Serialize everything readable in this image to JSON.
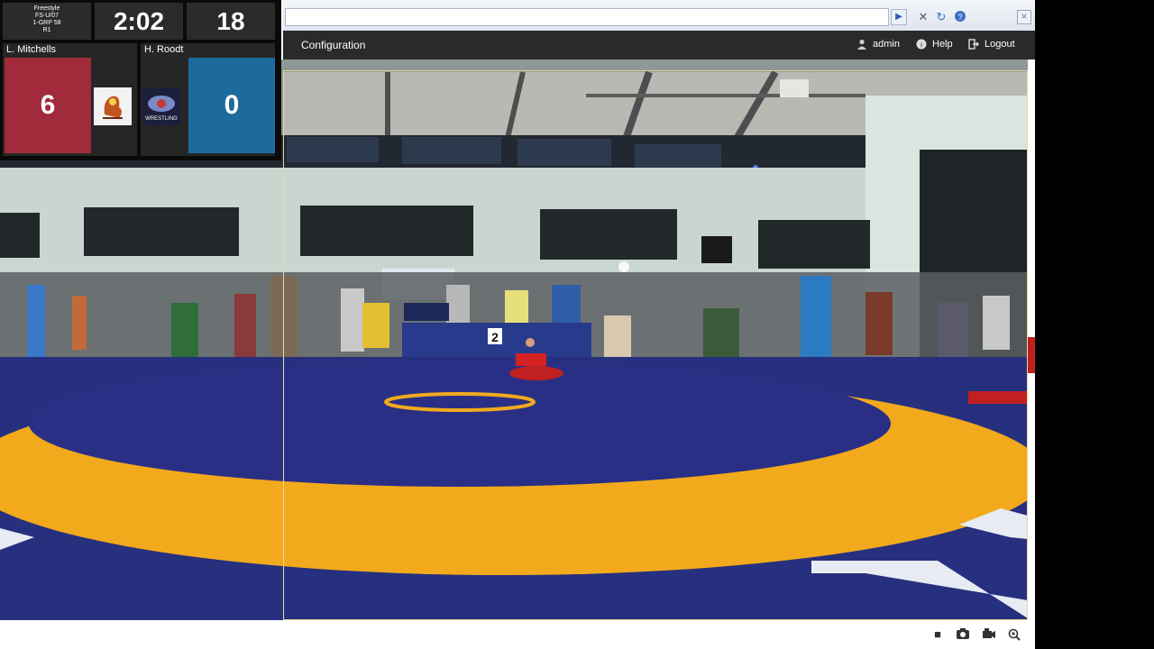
{
  "browser": {
    "url": "",
    "go_icon": "play-arrow-icon",
    "tool_icons": [
      "tools-icon",
      "refresh-icon",
      "help-circle-icon"
    ],
    "close_icon": "close-icon"
  },
  "navbar": {
    "config_label": "Configuration",
    "user_label": "admin",
    "help_label": "Help",
    "logout_label": "Logout"
  },
  "scoreboard": {
    "style": "Freestyle",
    "division": "FS-U/07",
    "bracket": "1-GRP 58",
    "round": "R1",
    "clock": "2:02",
    "weight": "18",
    "red": {
      "name": "L. Mitchells",
      "score": "6",
      "color": "#a12b3a"
    },
    "blue": {
      "name": "H. Roodt",
      "score": "0",
      "color": "#1d6a9c",
      "logo_text": "WRESTLING"
    }
  },
  "mat": {
    "table_number": "2",
    "colors": {
      "mat": "#27307f",
      "ring": "#f2aa1c",
      "center": "#2a2f86"
    }
  },
  "bottombar": {
    "icons": [
      "stop-icon",
      "camera-icon",
      "record-icon",
      "zoom-in-icon"
    ]
  }
}
